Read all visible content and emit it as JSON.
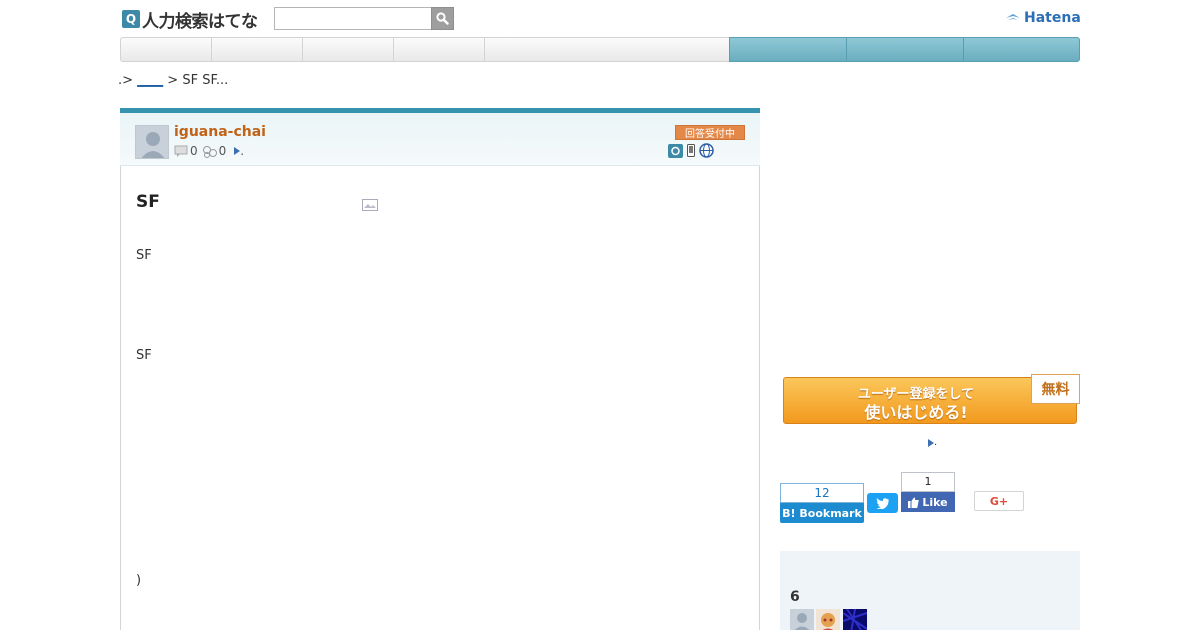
{
  "header": {
    "logo_icon": "Q",
    "logo_text": "人力検索はてな",
    "search_value": "",
    "hatena_text": "Hatena"
  },
  "nav": {
    "items": [
      "",
      "",
      "",
      "",
      "",
      "",
      "",
      ""
    ]
  },
  "breadcrumb": {
    "prefix": ".> ",
    "link": "____",
    "sep": " > ",
    "current": "SF SF..."
  },
  "question": {
    "username": "iguana-chai",
    "comment_count": "0",
    "star_count": "0",
    "more": ".",
    "status": "回答受付中",
    "title": "SF",
    "paragraphs": [
      "SF",
      "SF",
      ")"
    ]
  },
  "sidebar": {
    "register_line1": "ユーザー登録をして",
    "register_line2": "使いはじめる!",
    "free_label": "無料",
    "more_link": ".",
    "bookmark_count": "12",
    "bookmark_label": "B! Bookmark",
    "fb_count": "1",
    "fb_label": "Like",
    "gplus_label": "G+",
    "watch_count": "6"
  },
  "colors": {
    "accent": "#3593ad",
    "username": "#c06318",
    "status": "#e48848",
    "register": "#f29a1e"
  }
}
